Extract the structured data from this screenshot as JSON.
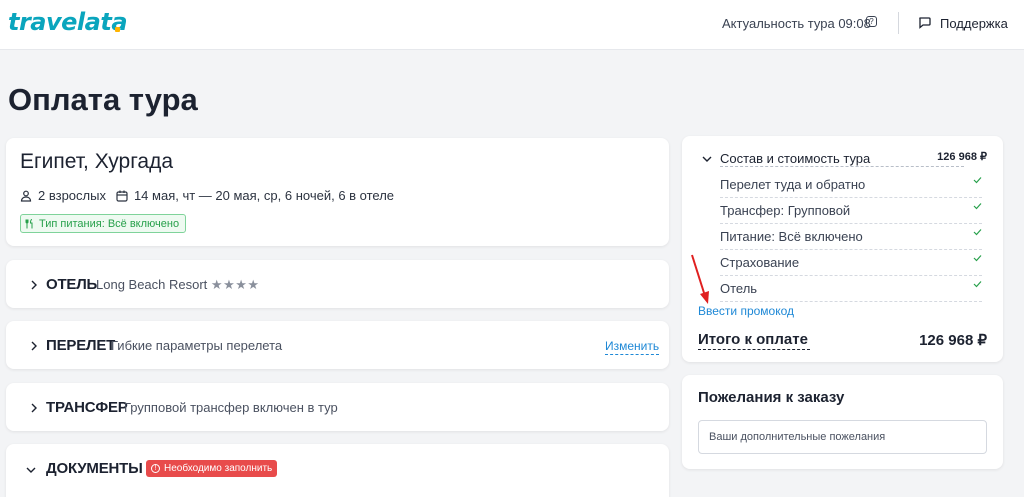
{
  "header": {
    "logo": "travelata",
    "actual_label": "Актуальность тура 09:08",
    "help_glyph": "?",
    "support_label": "Поддержка"
  },
  "page_title": "Оплата тура",
  "tour": {
    "title": "Египет, Хургада",
    "travelers": "2 взрослых",
    "dates": "14 мая, чт — 20 мая, ср, 6 ночей, 6 в отеле",
    "meal_badge": "Тип питания: Всё включено"
  },
  "sections": {
    "hotel": {
      "title": "ОТЕЛЬ",
      "subtitle": "Long Beach Resort",
      "stars": "★★★★"
    },
    "flight": {
      "title": "ПЕРЕЛЕТ",
      "subtitle": "Гибкие параметры перелета",
      "action": "Изменить"
    },
    "transfer": {
      "title": "ТРАНСФЕР",
      "subtitle": "Групповой трансфер включен в тур"
    },
    "documents": {
      "title": "ДОКУМЕНТЫ",
      "badge": "Необходимо заполнить",
      "badge_glyph": "!"
    }
  },
  "cost": {
    "title": "Состав и стоимость тура",
    "price": "126 968 ₽",
    "items": [
      {
        "label": "Перелет туда и обратно"
      },
      {
        "label": "Трансфер: Групповой"
      },
      {
        "label": "Питание: Всё включено"
      },
      {
        "label": "Страхование"
      },
      {
        "label": "Отель"
      }
    ],
    "promo_link": "Ввести промокод",
    "total_label": "Итого к оплате",
    "total_price": "126 968 ₽"
  },
  "wishes": {
    "title": "Пожелания к заказу",
    "placeholder": "Ваши дополнительные пожелания"
  },
  "colors": {
    "brand": "#0aa5bd",
    "link": "#1e88d6",
    "success": "#27a04b",
    "danger": "#e84b4b",
    "annotation_arrow": "#e02020"
  },
  "icons": {
    "travelers": "person-icon",
    "dates": "calendar-icon",
    "meal": "fork-knife-icon",
    "support": "chat-icon",
    "check": "check-icon",
    "expand": "chevron-right-icon",
    "collapse": "chevron-down-icon"
  }
}
